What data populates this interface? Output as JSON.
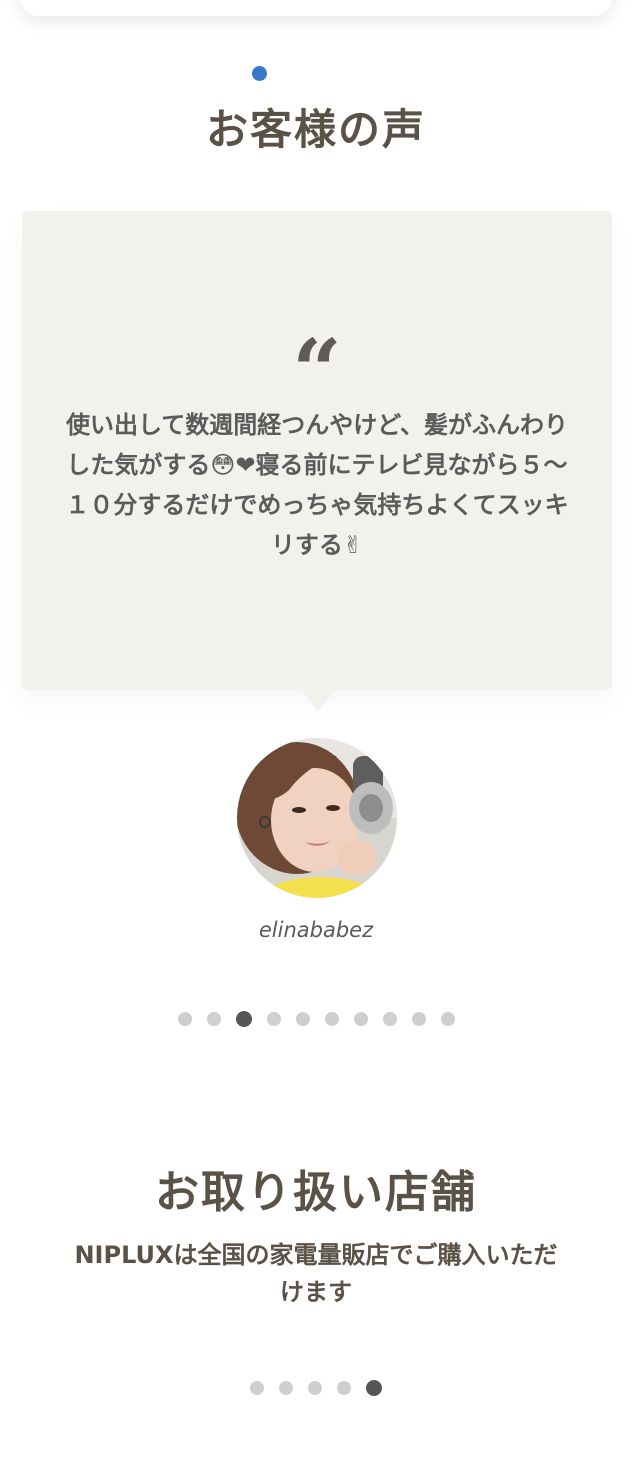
{
  "colors": {
    "accent_dot": "#3a78c9",
    "heading_text": "#5b5247",
    "card_background": "#f3f1ec",
    "dot_inactive": "#cfcfcf",
    "dot_active": "#565656"
  },
  "voices": {
    "title": "お客様の声",
    "quote_icon": "quote-icon",
    "testimonial": {
      "text": "使い出して数週間経つんやけど、髪がふんわりした気がする😳❤寝る前にテレビ見ながら５〜１０分するだけでめっちゃ気持ちよくてスッキリする✌",
      "username": "elinababez"
    },
    "carousel": {
      "total": 10,
      "active_index": 2
    }
  },
  "stores": {
    "title": "お取り扱い店舗",
    "description": "NIPLUXは全国の家電量販店でご購入いただけます",
    "carousel": {
      "total": 5,
      "active_index": 4
    }
  }
}
